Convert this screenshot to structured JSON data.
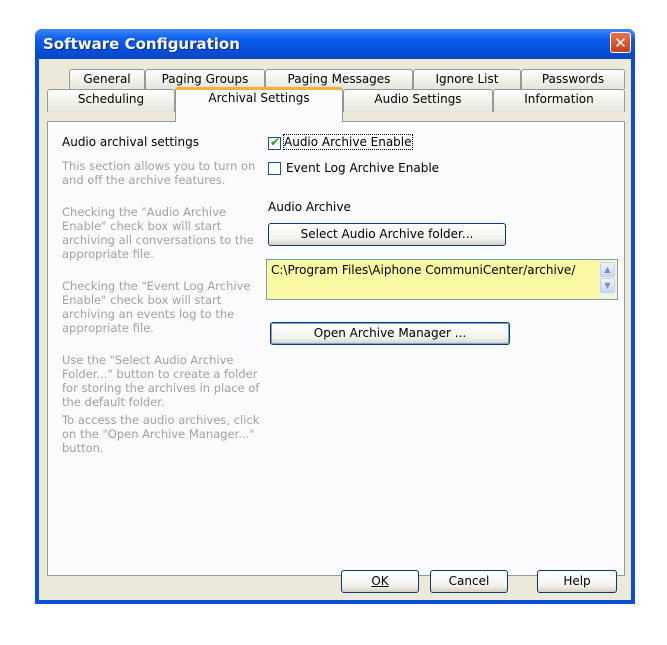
{
  "window": {
    "title": "Software Configuration",
    "close_glyph": "✕"
  },
  "tabs_row1": [
    "General",
    "Paging Groups",
    "Paging Messages",
    "Ignore List",
    "Passwords"
  ],
  "tabs_row2": [
    "Scheduling",
    "Archival Settings",
    "Audio Settings",
    "Information"
  ],
  "active_tab": "Archival Settings",
  "panel": {
    "heading": "Audio archival settings",
    "help": [
      "This section allows you to turn on and off the archive features.",
      "Checking the \"Audio Archive Enable\" check box will start archiving all conversations to the appropriate file.",
      "Checking the \"Event Log Archive Enable\" check box will start archiving an events log to the appropriate file.",
      "Use the \"Select Audio Archive Folder...\" button to create a folder for storing the archives in place of the default folder.",
      "To access the audio archives, click on the \"Open Archive Manager...\" button."
    ],
    "audio_archive_enable": {
      "label": "Audio Archive Enable",
      "checked": true
    },
    "event_log_archive_enable": {
      "label": "Event Log Archive Enable",
      "checked": false
    },
    "audio_archive_label": "Audio Archive",
    "select_folder_button": "Select Audio Archive folder...",
    "archive_path": "C:\\Program Files\\Aiphone CommuniCenter/archive/",
    "open_manager_button": "Open Archive Manager ..."
  },
  "footer": {
    "ok": "OK",
    "cancel": "Cancel",
    "help": "Help"
  },
  "icons": {
    "scroll_up": "scroll-up-arrow-icon",
    "scroll_down": "scroll-down-arrow-icon",
    "check": "checkmark-icon"
  }
}
